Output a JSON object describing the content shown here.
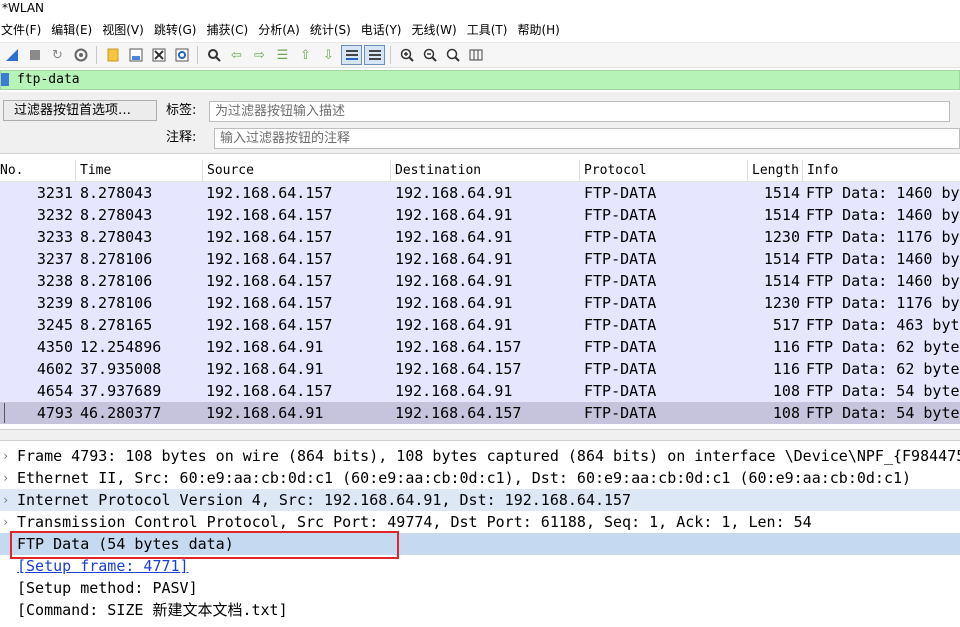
{
  "window": {
    "title": "*WLAN"
  },
  "menu": [
    "文件(F)",
    "编辑(E)",
    "视图(V)",
    "跳转(G)",
    "捕获(C)",
    "分析(A)",
    "统计(S)",
    "电话(Y)",
    "无线(W)",
    "工具(T)",
    "帮助(H)"
  ],
  "toolbar_icons": [
    "shark-fin-icon",
    "stop-icon",
    "restart-icon",
    "options-gear-icon",
    "open-folder-icon",
    "save-file-icon",
    "close-file-icon",
    "reload-icon",
    "find-icon",
    "back-arrow-icon",
    "forward-arrow-icon",
    "go-to-packet-icon",
    "first-packet-icon",
    "last-packet-icon",
    "autoscroll-icon",
    "colorize-icon",
    "zoom-in-icon",
    "zoom-out-icon",
    "zoom-reset-icon",
    "resize-columns-icon"
  ],
  "filter": {
    "value": "ftp-data",
    "bg_color": "#b6f3b6"
  },
  "filter_buttons": {
    "pref_button": "过滤器按钮首选项…",
    "label_label": "标签:",
    "label_placeholder": "为过滤器按钮输入描述",
    "comment_label": "注释:",
    "comment_placeholder": "输入过滤器按钮的注释"
  },
  "packet_list": {
    "columns": [
      "No.",
      "Time",
      "Source",
      "Destination",
      "Protocol",
      "Length",
      "Info"
    ],
    "rows": [
      {
        "no": "3231",
        "time": "8.278043",
        "src": "192.168.64.157",
        "dst": "192.168.64.91",
        "proto": "FTP-DATA",
        "len": "1514",
        "info": "FTP Data: 1460 by"
      },
      {
        "no": "3232",
        "time": "8.278043",
        "src": "192.168.64.157",
        "dst": "192.168.64.91",
        "proto": "FTP-DATA",
        "len": "1514",
        "info": "FTP Data: 1460 by"
      },
      {
        "no": "3233",
        "time": "8.278043",
        "src": "192.168.64.157",
        "dst": "192.168.64.91",
        "proto": "FTP-DATA",
        "len": "1230",
        "info": "FTP Data: 1176 by"
      },
      {
        "no": "3237",
        "time": "8.278106",
        "src": "192.168.64.157",
        "dst": "192.168.64.91",
        "proto": "FTP-DATA",
        "len": "1514",
        "info": "FTP Data: 1460 by"
      },
      {
        "no": "3238",
        "time": "8.278106",
        "src": "192.168.64.157",
        "dst": "192.168.64.91",
        "proto": "FTP-DATA",
        "len": "1514",
        "info": "FTP Data: 1460 by"
      },
      {
        "no": "3239",
        "time": "8.278106",
        "src": "192.168.64.157",
        "dst": "192.168.64.91",
        "proto": "FTP-DATA",
        "len": "1230",
        "info": "FTP Data: 1176 by"
      },
      {
        "no": "3245",
        "time": "8.278165",
        "src": "192.168.64.157",
        "dst": "192.168.64.91",
        "proto": "FTP-DATA",
        "len": "517",
        "info": "FTP Data: 463 byt"
      },
      {
        "no": "4350",
        "time": "12.254896",
        "src": "192.168.64.91",
        "dst": "192.168.64.157",
        "proto": "FTP-DATA",
        "len": "116",
        "info": "FTP Data: 62 byte"
      },
      {
        "no": "4602",
        "time": "37.935008",
        "src": "192.168.64.91",
        "dst": "192.168.64.157",
        "proto": "FTP-DATA",
        "len": "116",
        "info": "FTP Data: 62 byte"
      },
      {
        "no": "4654",
        "time": "37.937689",
        "src": "192.168.64.157",
        "dst": "192.168.64.91",
        "proto": "FTP-DATA",
        "len": "108",
        "info": "FTP Data: 54 byte"
      },
      {
        "no": "4793",
        "time": "46.280377",
        "src": "192.168.64.91",
        "dst": "192.168.64.157",
        "proto": "FTP-DATA",
        "len": "108",
        "info": "FTP Data: 54 byte"
      }
    ],
    "row_color": "#e7e6ff",
    "selected_row_color": "#c6c4dc"
  },
  "details": {
    "lines": [
      {
        "text": "Frame 4793: 108 bytes on wire (864 bits), 108 bytes captured (864 bits) on interface \\Device\\NPF_{F984475",
        "arrow": "›"
      },
      {
        "text": "Ethernet II, Src: 60:e9:aa:cb:0d:c1 (60:e9:aa:cb:0d:c1), Dst: 60:e9:aa:cb:0d:c1 (60:e9:aa:cb:0d:c1)",
        "arrow": "›"
      },
      {
        "text": "Internet Protocol Version 4, Src: 192.168.64.91, Dst: 192.168.64.157",
        "arrow": "›"
      },
      {
        "text": "Transmission Control Protocol, Src Port: 49774, Dst Port: 61188, Seq: 1, Ack: 1, Len: 54",
        "arrow": "›"
      },
      {
        "text": "FTP Data (54 bytes data)",
        "arrow": ""
      },
      {
        "text": "[Setup frame: 4771]",
        "arrow": ""
      },
      {
        "text": "[Setup method: PASV]",
        "arrow": ""
      },
      {
        "text": "[Command: SIZE 新建文本文档.txt]",
        "arrow": ""
      }
    ],
    "highlight_color": "#dce8f6",
    "selected_color": "#c5daf0",
    "annotation_color": "#e0262a"
  }
}
